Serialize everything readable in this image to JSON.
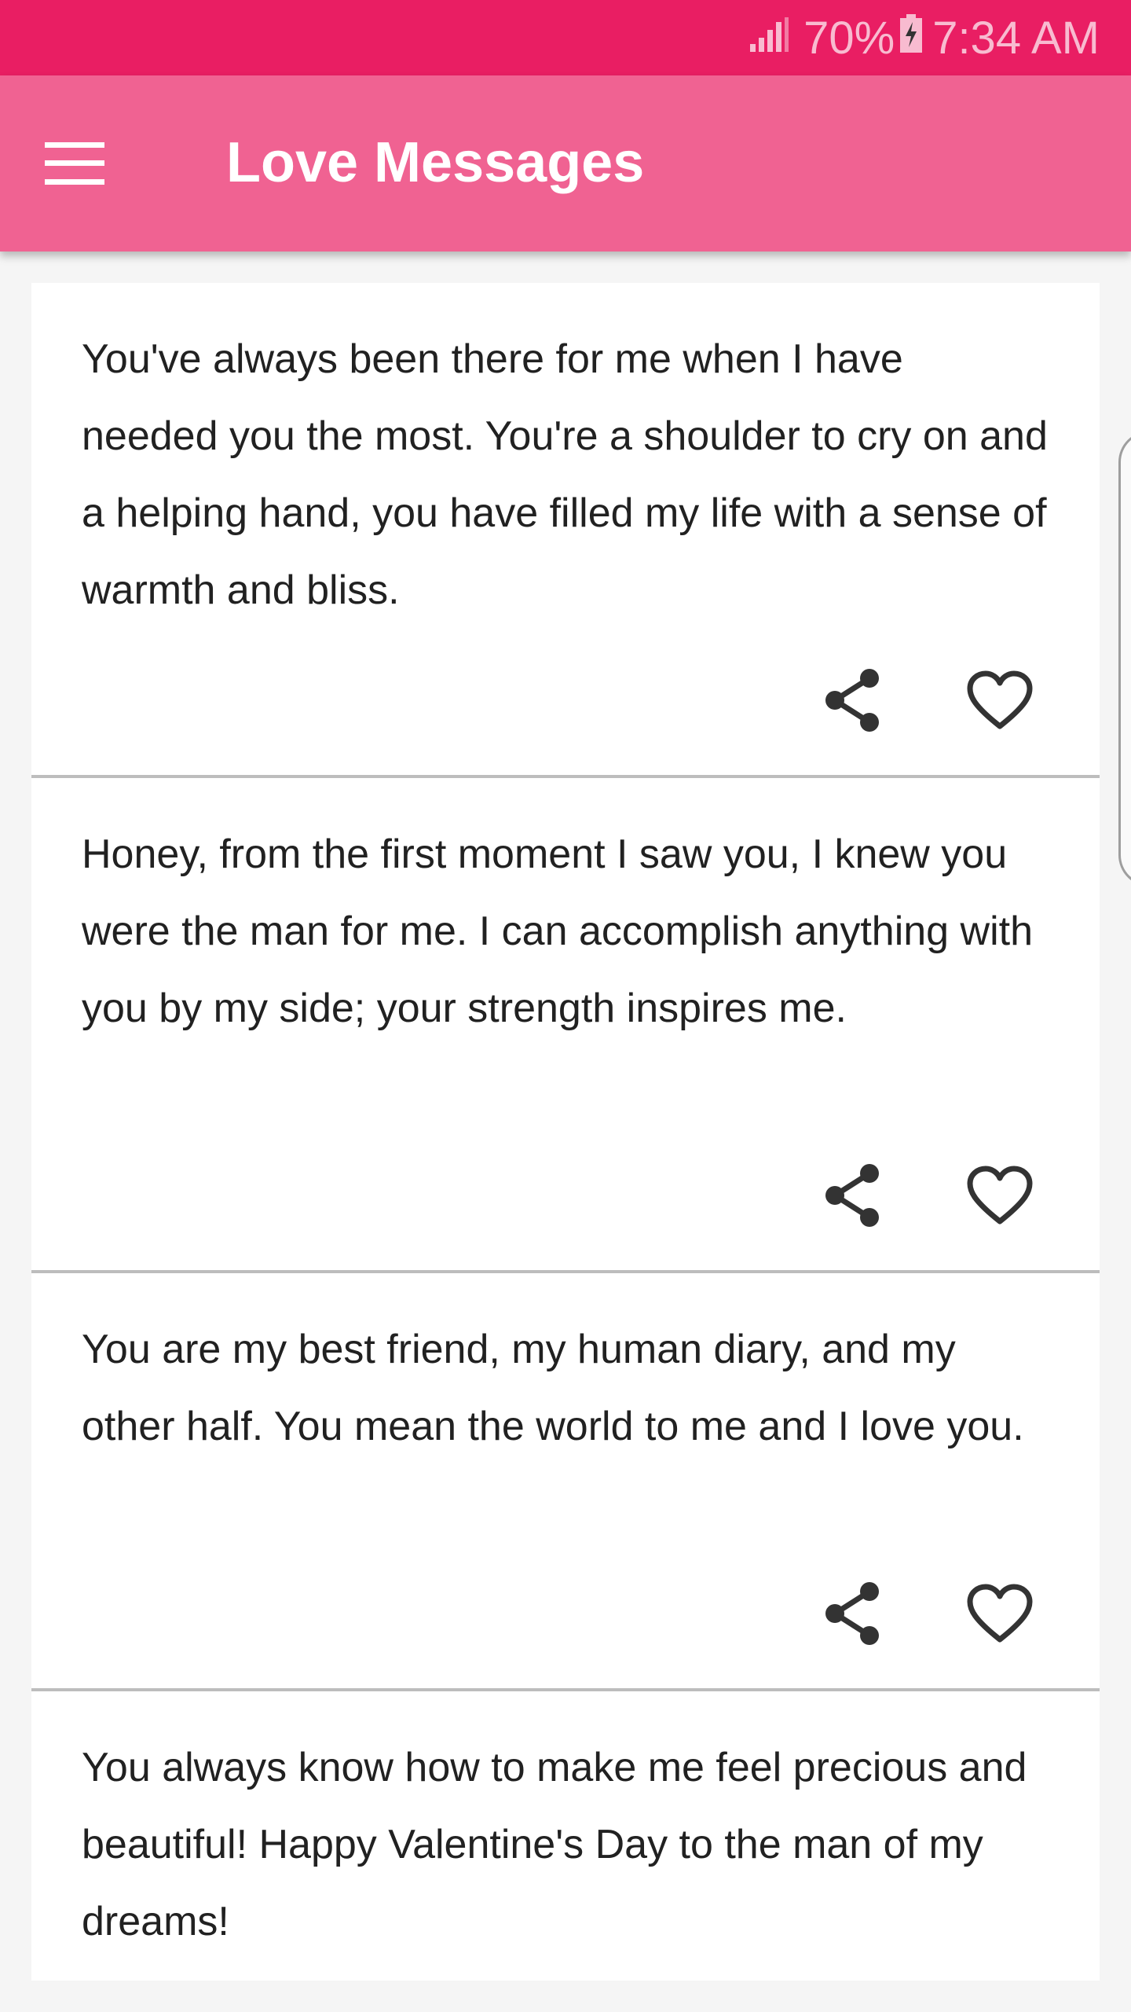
{
  "status_bar": {
    "battery_percent": "70%",
    "time": "7:34 AM",
    "icons": [
      "signal-icon",
      "battery-charging-icon"
    ]
  },
  "app_bar": {
    "title": "Love Messages",
    "menu_icon": "hamburger-menu-icon",
    "color": "#f06292"
  },
  "colors": {
    "status_bar": "#e91e63",
    "app_bar": "#f06292",
    "background": "#f5f5f5",
    "card": "#ffffff",
    "icon": "#333333"
  },
  "messages": [
    {
      "text": "You've always been there for me when I have needed you the most. You're a shoulder to cry on and a helping hand, you have filled my life with a sense of warmth and bliss.",
      "share_icon": "share-icon",
      "favorite_icon": "heart-outline-icon"
    },
    {
      "text": "Honey, from the first moment I saw you, I knew you were the man for me. I can accomplish anything with you by my side; your strength inspires me.",
      "share_icon": "share-icon",
      "favorite_icon": "heart-outline-icon"
    },
    {
      "text": "You are my best friend, my human diary, and my other half. You mean the world to me and I love you.",
      "share_icon": "share-icon",
      "favorite_icon": "heart-outline-icon"
    },
    {
      "text": "You always know how to make me feel precious and beautiful! Happy Valentine's Day to the man of my dreams!"
    }
  ]
}
